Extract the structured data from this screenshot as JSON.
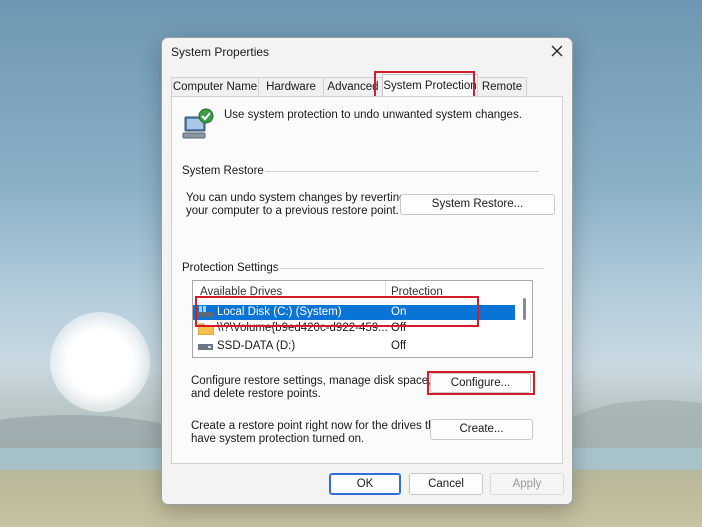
{
  "window": {
    "title": "System Properties"
  },
  "tabs": [
    {
      "label": "Computer Name"
    },
    {
      "label": "Hardware"
    },
    {
      "label": "Advanced"
    },
    {
      "label": "System Protection"
    },
    {
      "label": "Remote"
    }
  ],
  "intro": {
    "text": "Use system protection to undo unwanted system changes."
  },
  "system_restore": {
    "heading": "System Restore",
    "description_line1": "You can undo system changes by reverting",
    "description_line2": "your computer to a previous restore point.",
    "button": "System Restore..."
  },
  "protection": {
    "heading": "Protection Settings",
    "columns": {
      "drives": "Available Drives",
      "protection": "Protection"
    },
    "drives": [
      {
        "name": "Local Disk (C:) (System)",
        "protection": "On"
      },
      {
        "name": "\\\\?\\Volume{b9ed420c-d922-459...",
        "protection": "Off"
      },
      {
        "name": "SSD-DATA (D:)",
        "protection": "Off"
      }
    ],
    "configure_line1": "Configure restore settings, manage disk space,",
    "configure_line2": "and delete restore points.",
    "configure_button": "Configure...",
    "create_line1": "Create a restore point right now for the drives that",
    "create_line2": "have system protection turned on.",
    "create_button": "Create..."
  },
  "footer": {
    "ok": "OK",
    "cancel": "Cancel",
    "apply": "Apply"
  },
  "colors": {
    "highlight": "#d21e2b",
    "selection": "#0a73d6"
  }
}
